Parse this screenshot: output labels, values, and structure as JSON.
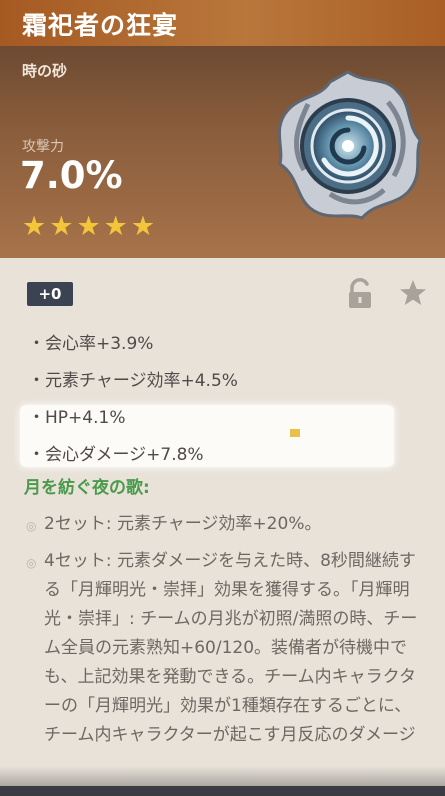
{
  "artifact": {
    "title": "霜祀者の狂宴",
    "slot": "時の砂",
    "main_stat_label": "攻撃力",
    "main_stat_value": "7.0%",
    "rarity_stars": 5,
    "level": "+0"
  },
  "substats": [
    "・会心率+3.9%",
    "・元素チャージ効率+4.5%",
    "・HP+4.1%",
    "・会心ダメージ+7.8%"
  ],
  "set": {
    "name": "月を紡ぐ夜の歌:",
    "bonus_2": "2セット: 元素チャージ効率+20%。",
    "bonus_4": "4セット: 元素ダメージを与えた時、8秒間継続する「月輝明光・崇拝」効果を獲得する。「月輝明光・崇拝」: チームの月兆が初照/満照の時、チーム全員の元素熟知+60/120。装備者が待機中でも、上記効果を発動できる。チーム内キャラクターの「月輝明光」効果が1種類存在するごとに、チーム内キャラクターが起こす月反応のダメージ"
  },
  "colors": {
    "title_bar": "#a95e25",
    "header": "#8a5d3c",
    "star": "#f2c53a",
    "set_name": "#4a9a4b",
    "badge": "#3b4252"
  },
  "icons": [
    "lock-icon",
    "star-favorite-icon",
    "artifact-sands-icon"
  ]
}
